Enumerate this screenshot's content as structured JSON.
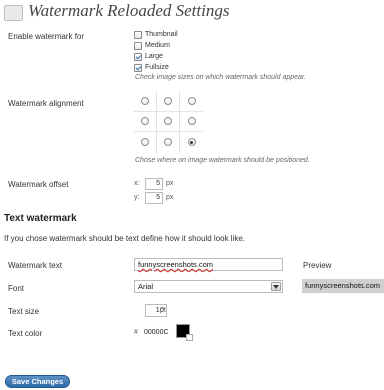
{
  "header": {
    "title": "Watermark Reloaded Settings",
    "icon": "settings-page-icon"
  },
  "enable": {
    "label": "Enable watermark for",
    "options": [
      {
        "label": "Thumbnail",
        "checked": false
      },
      {
        "label": "Medium",
        "checked": false
      },
      {
        "label": "Large",
        "checked": true
      },
      {
        "label": "Fullsize",
        "checked": true
      }
    ],
    "description": "Check image sizes on which watermark should appear."
  },
  "alignment": {
    "label": "Watermark alignment",
    "selected": "bottom-right",
    "description": "Chose where on image watermark should be positioned."
  },
  "offset": {
    "label": "Watermark offset",
    "x_label": "x:",
    "x_value": "5",
    "x_unit": "px",
    "y_label": "y:",
    "y_value": "5",
    "y_unit": "px"
  },
  "text_watermark": {
    "title": "Text watermark",
    "description": "If you chose watermark should be text define how it should look like.",
    "text_label": "Watermark text",
    "text_value": "funnyscreenshots.com",
    "preview_label": "Preview",
    "preview_text": "funnyscreenshots.com",
    "font_label": "Font",
    "font_value": "Arial",
    "size_label": "Text size",
    "size_value": "10",
    "size_unit": "pt",
    "color_label": "Text color",
    "color_hash": "#",
    "color_value": "00000C",
    "swatch_color": "#000000"
  },
  "actions": {
    "save_label": "Save Changes"
  },
  "colors": {
    "button": "#2d6aa8",
    "preview_bg": "#d0d0d0"
  }
}
